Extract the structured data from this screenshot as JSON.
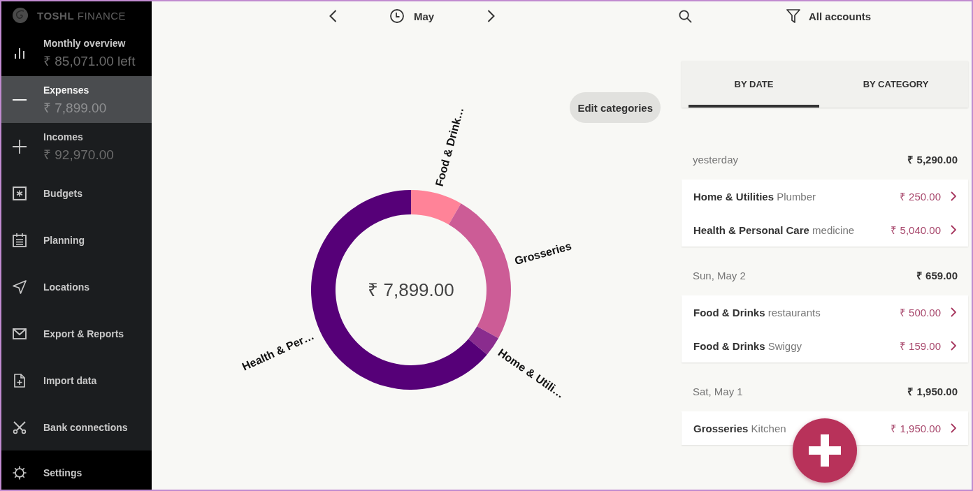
{
  "sidebar": {
    "logo": "**TOSHL** FINANCE",
    "overview": {
      "title": "Monthly overview",
      "value": "₹ 85,071.00 left"
    },
    "items": [
      {
        "label": "Expenses",
        "value": "₹ 7,899.00",
        "selected": true
      },
      {
        "label": "Incomes",
        "value": "₹ 92,970.00",
        "selected": false
      },
      {
        "label": "Budgets",
        "selected": false
      },
      {
        "label": "Planning",
        "selected": false
      },
      {
        "label": "Locations",
        "selected": false
      },
      {
        "label": "Export & Reports",
        "selected": false
      },
      {
        "label": "Import data",
        "selected": false
      },
      {
        "label": "Bank connections",
        "selected": false
      }
    ],
    "footer": {
      "label": "Settings"
    }
  },
  "month_nav": {
    "month": "May"
  },
  "chart": {
    "total": "₹ 7,899.00",
    "slice_labels": [
      "Food & Drink…",
      "Grosseries",
      "Home & Utili…",
      "Health & Per…"
    ],
    "edit_button": "Edit categories"
  },
  "toolbar": {
    "account_filter": "All accounts"
  },
  "tabs": [
    {
      "label": "BY DATE",
      "selected": true
    },
    {
      "label": "BY CATEGORY",
      "selected": false
    }
  ],
  "groups": [
    {
      "date": "yesterday",
      "total": "₹ 5,290.00",
      "entries": [
        {
          "text": "**Home & Utilities** Plumber",
          "amount": "₹ 250.00"
        },
        {
          "text": "**Health & Personal Care** medicine",
          "amount": "₹ 5,040.00"
        }
      ]
    },
    {
      "date": "Sun, May 2",
      "total": "₹ 659.00",
      "entries": [
        {
          "text": "**Food & Drinks** restaurants",
          "amount": "₹ 500.00"
        },
        {
          "text": "**Food & Drinks** Swiggy",
          "amount": "₹ 159.00"
        }
      ]
    },
    {
      "date": "Sat, May 1",
      "total": "₹ 1,950.00",
      "entries": [
        {
          "text": "**Grosseries** Kitchen",
          "amount": "₹ 1,950.00"
        }
      ]
    }
  ]
}
